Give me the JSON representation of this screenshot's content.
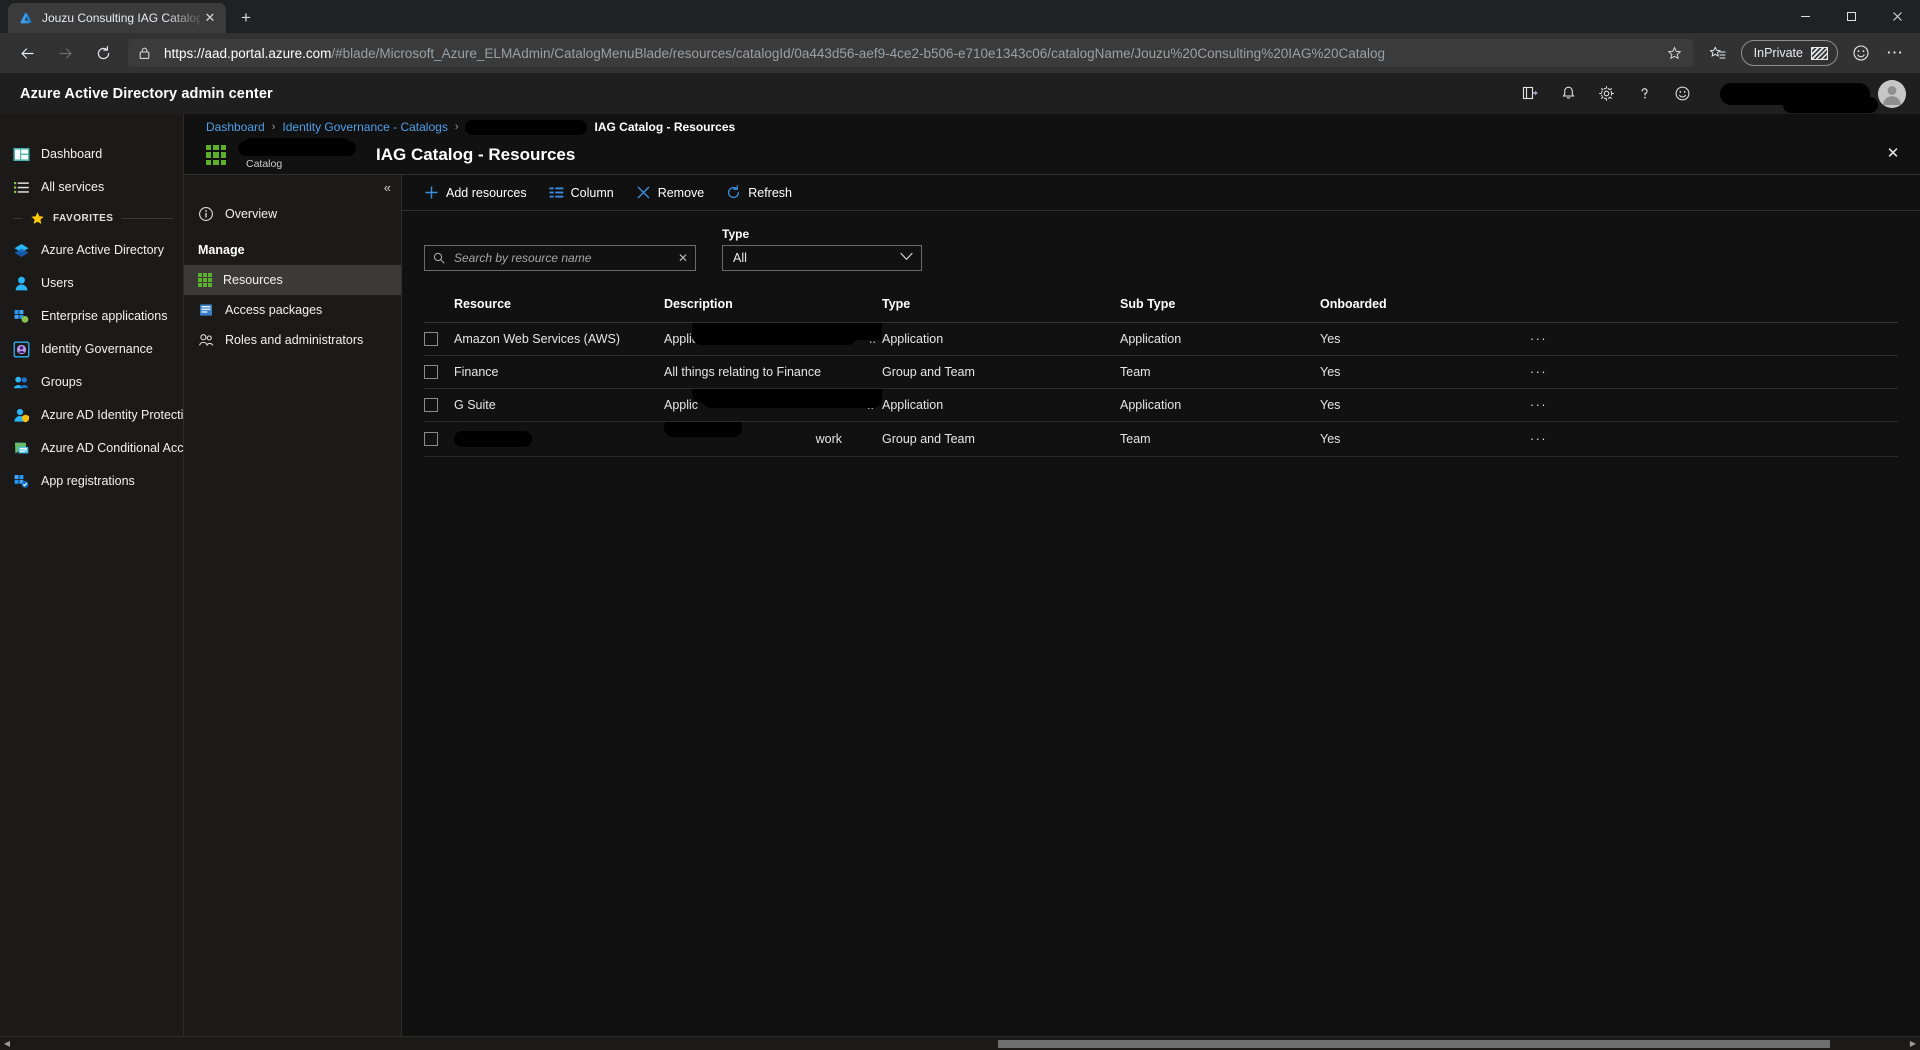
{
  "browser": {
    "tab": {
      "title": "Jouzu Consulting IAG Catalog -",
      "favicon": "azure-favicon",
      "close_label": "✕"
    },
    "new_tab_label": "+",
    "window_controls": {
      "minimize": "–",
      "maximize": "□",
      "close": "✕"
    },
    "nav": {
      "back": "←",
      "forward": "→",
      "reload": "↻"
    },
    "omnibox": {
      "lock_icon": "lock-icon",
      "url_host": "https://aad.portal.azure.com",
      "url_path": "/#blade/Microsoft_Azure_ELMAdmin/CatalogMenuBlade/resources/catalogId/0a443d56-aef9-4ce2-b506-e710e1343c06/catalogName/Jouzu%20Consulting%20IAG%20Catalog",
      "star_icon": "favorite-star-icon"
    },
    "toolbar": {
      "collections_label": "collections-icon",
      "inprivate_label": "InPrivate",
      "profile_icon": "smiley-face-icon",
      "settings_label": "⋯"
    }
  },
  "portal": {
    "brand": "Azure Active Directory admin center",
    "header_icons": [
      {
        "name": "cloud-shell-icon"
      },
      {
        "name": "notifications-bell-icon"
      },
      {
        "name": "settings-gear-icon"
      },
      {
        "name": "help-question-icon"
      },
      {
        "name": "feedback-smiley-icon"
      }
    ]
  },
  "sidebar": {
    "collapse_label": "«",
    "items": [
      {
        "label": "Dashboard",
        "icon": "dashboard-icon"
      },
      {
        "label": "All services",
        "icon": "all-services-icon"
      }
    ],
    "favorites_label": "FAVORITES",
    "favorites": [
      {
        "label": "Azure Active Directory",
        "icon": "azure-ad-icon"
      },
      {
        "label": "Users",
        "icon": "users-icon"
      },
      {
        "label": "Enterprise applications",
        "icon": "enterprise-apps-icon"
      },
      {
        "label": "Identity Governance",
        "icon": "identity-governance-icon"
      },
      {
        "label": "Groups",
        "icon": "groups-icon"
      },
      {
        "label": "Azure AD Identity Protection",
        "icon": "identity-protection-icon"
      },
      {
        "label": "Azure AD Conditional Access",
        "icon": "conditional-access-icon"
      },
      {
        "label": "App registrations",
        "icon": "app-registrations-icon"
      }
    ]
  },
  "breadcrumb": {
    "items": [
      {
        "label": "Dashboard",
        "type": "link"
      },
      {
        "label": "Identity Governance - Catalogs",
        "type": "link"
      },
      {
        "label": "",
        "type": "redacted"
      }
    ],
    "current": "IAG Catalog - Resources",
    "separator": "›"
  },
  "blade": {
    "icon": "catalog-grid-icon",
    "subtitle_redacted": "",
    "subtitle": "Catalog",
    "title": "IAG Catalog - Resources",
    "close_label": "✕",
    "collapse_label": "«"
  },
  "blade_menu": {
    "collapse_label": "«",
    "items": [
      {
        "label": "Overview",
        "icon": "info-circle-icon",
        "selected": false
      },
      {
        "label": "Manage",
        "type": "section"
      },
      {
        "label": "Resources",
        "icon": "resources-grid-icon",
        "selected": true
      },
      {
        "label": "Access packages",
        "icon": "access-packages-icon",
        "selected": false
      },
      {
        "label": "Roles and administrators",
        "icon": "roles-admins-icon",
        "selected": false
      }
    ]
  },
  "command_bar": [
    {
      "label": "Add resources",
      "icon": "plus-icon"
    },
    {
      "label": "Column",
      "icon": "columns-icon"
    },
    {
      "label": "Remove",
      "icon": "close-x-icon"
    },
    {
      "label": "Refresh",
      "icon": "refresh-icon"
    }
  ],
  "filters": {
    "search": {
      "placeholder": "Search by resource name",
      "value": "",
      "icon": "search-icon",
      "clear_icon": "clear-x-icon"
    },
    "type": {
      "label": "Type",
      "value": "All",
      "chevron": "∨"
    }
  },
  "table": {
    "columns": [
      "Resource",
      "Description",
      "Type",
      "Sub Type",
      "Onboarded"
    ],
    "rows": [
      {
        "resource": "Amazon Web Services (AWS)",
        "description_prefix": "Applic",
        "description_suffix": "..",
        "description_redacted": true,
        "resource_redacted": false,
        "type": "Application",
        "sub_type": "Application",
        "onboarded": "Yes",
        "menu": "···"
      },
      {
        "resource": "Finance",
        "description_prefix": "All things relating to Finance",
        "description_suffix": "",
        "description_redacted": false,
        "resource_redacted": false,
        "type": "Group and Team",
        "sub_type": "Team",
        "onboarded": "Yes",
        "menu": "···"
      },
      {
        "resource": "G Suite",
        "description_prefix": "Applic",
        "description_suffix": "..",
        "description_redacted": true,
        "resource_redacted": false,
        "type": "Application",
        "sub_type": "Application",
        "onboarded": "Yes",
        "menu": "···"
      },
      {
        "resource": "",
        "description_prefix": "",
        "description_suffix": "work",
        "description_redacted": true,
        "resource_redacted": true,
        "type": "Group and Team",
        "sub_type": "Team",
        "onboarded": "Yes",
        "menu": "···"
      }
    ]
  },
  "colors": {
    "accent_blue": "#3b8fe0",
    "link_blue": "#4ea0e8",
    "catalog_green": "#5cb02c",
    "portal_bg": "#1b1a19",
    "blade_bg": "#111111"
  }
}
